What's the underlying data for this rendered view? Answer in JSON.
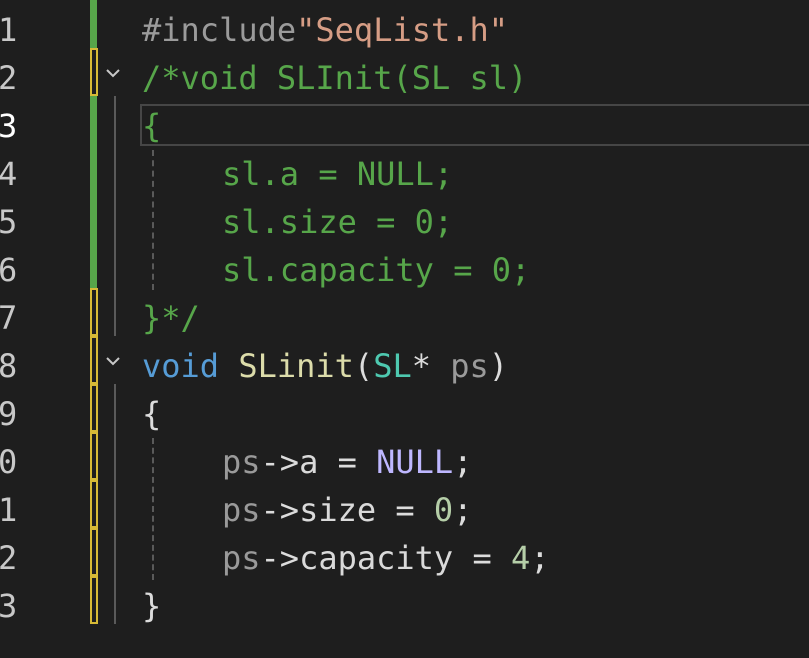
{
  "editor": {
    "line_numbers": [
      "1",
      "2",
      "3",
      "4",
      "5",
      "6",
      "7",
      "8",
      "9",
      "0",
      "1",
      "2",
      "3"
    ],
    "lines": [
      {
        "tokens": [
          {
            "t": "#include",
            "c": "c-pre"
          },
          {
            "t": "\"SeqList.h\"",
            "c": "c-str"
          }
        ]
      },
      {
        "tokens": [
          {
            "t": "/*void SLInit(SL sl)",
            "c": "c-comment"
          }
        ]
      },
      {
        "tokens": [
          {
            "t": "{",
            "c": "c-comment"
          }
        ]
      },
      {
        "tokens": [
          {
            "t": "sl.a = NULL;",
            "c": "c-comment"
          }
        ]
      },
      {
        "tokens": [
          {
            "t": "sl.size = 0;",
            "c": "c-comment"
          }
        ]
      },
      {
        "tokens": [
          {
            "t": "sl.capacity = 0;",
            "c": "c-comment"
          }
        ]
      },
      {
        "tokens": [
          {
            "t": "}*/",
            "c": "c-comment"
          }
        ]
      },
      {
        "tokens": [
          {
            "t": "void",
            "c": "c-kw"
          },
          {
            "t": " ",
            "c": "c-text"
          },
          {
            "t": "SLinit",
            "c": "c-fn"
          },
          {
            "t": "(",
            "c": "c-text"
          },
          {
            "t": "SL",
            "c": "c-type"
          },
          {
            "t": "* ",
            "c": "c-text"
          },
          {
            "t": "ps",
            "c": "c-param"
          },
          {
            "t": ")",
            "c": "c-text"
          }
        ]
      },
      {
        "tokens": [
          {
            "t": "{",
            "c": "c-text"
          }
        ]
      },
      {
        "tokens": [
          {
            "t": "ps",
            "c": "c-param"
          },
          {
            "t": "->",
            "c": "c-text"
          },
          {
            "t": "a",
            "c": "c-field"
          },
          {
            "t": " = ",
            "c": "c-text"
          },
          {
            "t": "NULL",
            "c": "c-macro"
          },
          {
            "t": ";",
            "c": "c-text"
          }
        ]
      },
      {
        "tokens": [
          {
            "t": "ps",
            "c": "c-param"
          },
          {
            "t": "->",
            "c": "c-text"
          },
          {
            "t": "size",
            "c": "c-field"
          },
          {
            "t": " = ",
            "c": "c-text"
          },
          {
            "t": "0",
            "c": "c-num"
          },
          {
            "t": ";",
            "c": "c-text"
          }
        ]
      },
      {
        "tokens": [
          {
            "t": "ps",
            "c": "c-param"
          },
          {
            "t": "->",
            "c": "c-text"
          },
          {
            "t": "capacity",
            "c": "c-field"
          },
          {
            "t": " = ",
            "c": "c-text"
          },
          {
            "t": "4",
            "c": "c-num"
          },
          {
            "t": ";",
            "c": "c-text"
          }
        ]
      },
      {
        "tokens": [
          {
            "t": "}",
            "c": "c-text"
          }
        ]
      }
    ],
    "change_marks": [
      "green",
      "yellow",
      "green",
      "green",
      "green",
      "green",
      "yellow",
      "yellow",
      "yellow",
      "yellow",
      "yellow",
      "yellow",
      "yellow"
    ],
    "fold_lines": [
      1,
      7
    ],
    "active_line": 2,
    "colors": {
      "background": "#1e1e1e",
      "saved_change": "#57a64a",
      "unsaved_change": "#d7ba36",
      "comment": "#57a64a",
      "keyword": "#569cd6",
      "function": "#dcdcaa",
      "type": "#4ec9b0",
      "string": "#d69d85",
      "macro": "#beb7ff",
      "number": "#b5cea8"
    },
    "icons": {
      "fold": "chevron-down-icon"
    }
  }
}
